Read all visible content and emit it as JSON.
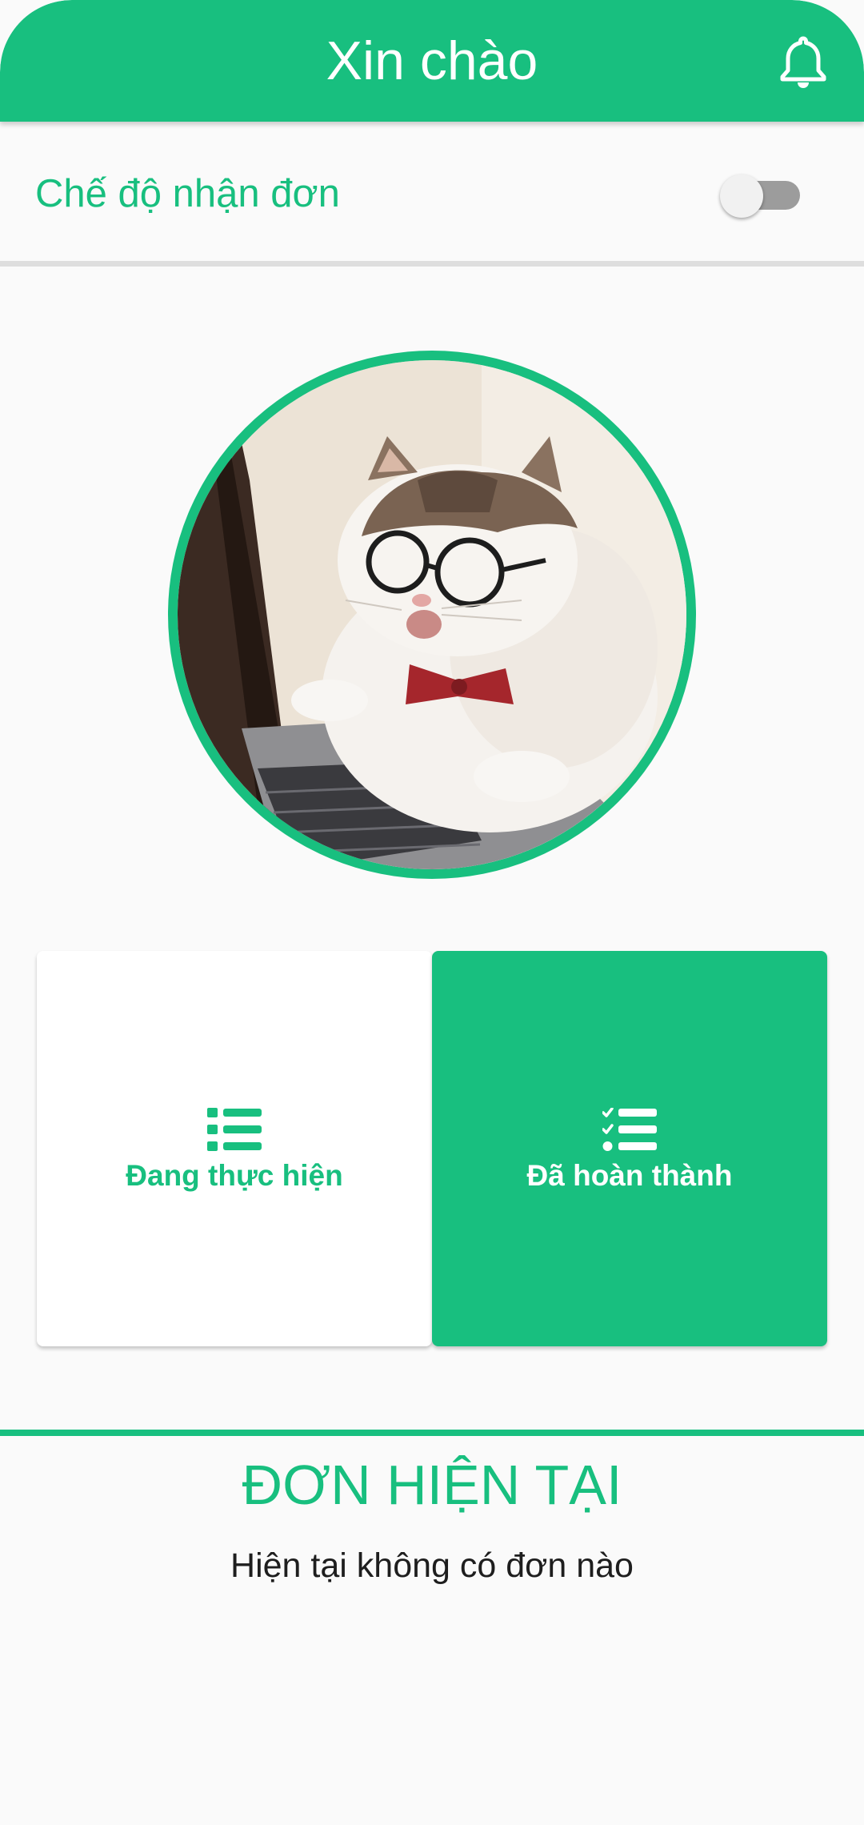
{
  "appbar": {
    "title": "Xin chào",
    "notification_icon": "bell-icon",
    "color": "#18bf7f"
  },
  "order_mode": {
    "label": "Chế độ nhận đơn",
    "enabled": false
  },
  "avatar": {
    "description_icon": "cat-with-glasses-avatar",
    "ring_color": "#18bf7f"
  },
  "tiles": [
    {
      "label": "Đang thực hiện",
      "icon": "list-icon",
      "selected": false
    },
    {
      "label": "Đã hoàn thành",
      "icon": "checklist-icon",
      "selected": true
    }
  ],
  "current_orders": {
    "title": "ĐƠN HIỆN TẠI",
    "empty_message": "Hiện tại không có đơn nào"
  },
  "colors": {
    "accent": "#18bf7f",
    "background": "#fafafa",
    "text": "#1e1e1e"
  }
}
